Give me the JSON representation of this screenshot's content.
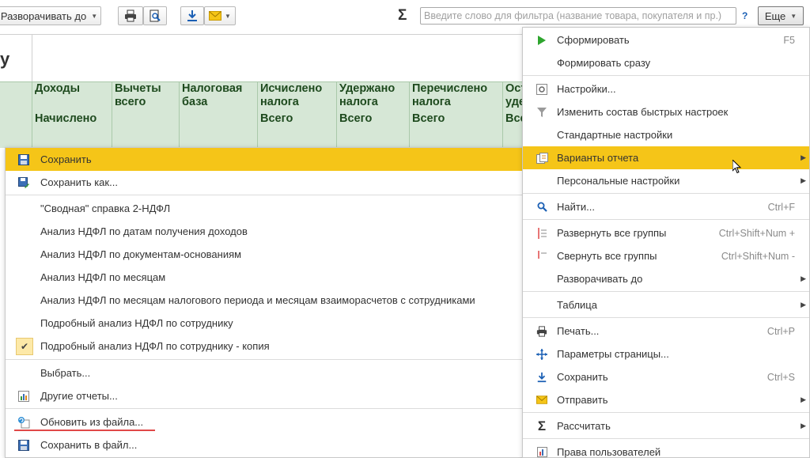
{
  "toolbar": {
    "expand_to_label": "Разворачивать до",
    "search_placeholder": "Введите слово для фильтра (название товара, покупателя и пр.)",
    "help_label": "?",
    "more_label": "Еще"
  },
  "report": {
    "title_fragment": "у",
    "columns": [
      {
        "title": "Доходы",
        "sub": "Начислено"
      },
      {
        "title": "Вычеты всего",
        "sub": ""
      },
      {
        "title": "Налоговая база",
        "sub": ""
      },
      {
        "title": "Исчислено налога",
        "sub": "Всего"
      },
      {
        "title": "Удержано налога",
        "sub": "Всего"
      },
      {
        "title": "Перечислено налога",
        "sub": "Всего"
      },
      {
        "title": "Ост уде",
        "sub": "Все"
      }
    ]
  },
  "left_menu": {
    "items": [
      {
        "label": "Сохранить",
        "icon": "floppy-icon"
      },
      {
        "label": "Сохранить как...",
        "icon": "save-as-icon"
      },
      {
        "label": "\"Сводная\" справка 2-НДФЛ"
      },
      {
        "label": "Анализ НДФЛ по датам получения доходов"
      },
      {
        "label": "Анализ НДФЛ по документам-основаниям"
      },
      {
        "label": "Анализ НДФЛ по месяцам"
      },
      {
        "label": "Анализ НДФЛ по месяцам налогового периода и месяцам взаиморасчетов с сотрудниками"
      },
      {
        "label": "Подробный анализ НДФЛ по сотруднику"
      },
      {
        "label": "Подробный анализ НДФЛ по сотруднику - копия",
        "icon": "check-icon"
      },
      {
        "label": "Выбрать..."
      },
      {
        "label": "Другие отчеты...",
        "icon": "reports-icon"
      },
      {
        "label": "Обновить из файла...",
        "icon": "update-from-file-icon"
      },
      {
        "label": "Сохранить в файл...",
        "icon": "save-to-file-icon"
      }
    ]
  },
  "right_menu": {
    "items": [
      {
        "label": "Сформировать",
        "shortcut": "F5",
        "icon": "play-icon"
      },
      {
        "label": "Формировать сразу"
      },
      {
        "label": "Настройки...",
        "icon": "settings-icon"
      },
      {
        "label": "Изменить состав быстрых настроек",
        "icon": "filter-icon"
      },
      {
        "label": "Стандартные настройки"
      },
      {
        "label": "Варианты отчета",
        "icon": "report-variants-icon"
      },
      {
        "label": "Персональные настройки"
      },
      {
        "label": "Найти...",
        "shortcut": "Ctrl+F",
        "icon": "find-icon"
      },
      {
        "label": "Развернуть все группы",
        "shortcut": "Ctrl+Shift+Num +",
        "icon": "expand-groups-icon"
      },
      {
        "label": "Свернуть все группы",
        "shortcut": "Ctrl+Shift+Num -",
        "icon": "collapse-groups-icon"
      },
      {
        "label": "Разворачивать до"
      },
      {
        "label": "Таблица"
      },
      {
        "label": "Печать...",
        "shortcut": "Ctrl+P",
        "icon": "print-icon"
      },
      {
        "label": "Параметры страницы...",
        "icon": "page-setup-icon"
      },
      {
        "label": "Сохранить",
        "shortcut": "Ctrl+S",
        "icon": "download-icon"
      },
      {
        "label": "Отправить",
        "icon": "mail-icon"
      },
      {
        "label": "Рассчитать",
        "icon": "sigma-icon"
      },
      {
        "label": "Права пользователей",
        "icon": "user-rights-icon"
      }
    ]
  },
  "colors": {
    "selection": "#f5c518",
    "header_bg": "#d6e7d6",
    "header_text": "#1e4a1e",
    "underline": "#e04848"
  }
}
